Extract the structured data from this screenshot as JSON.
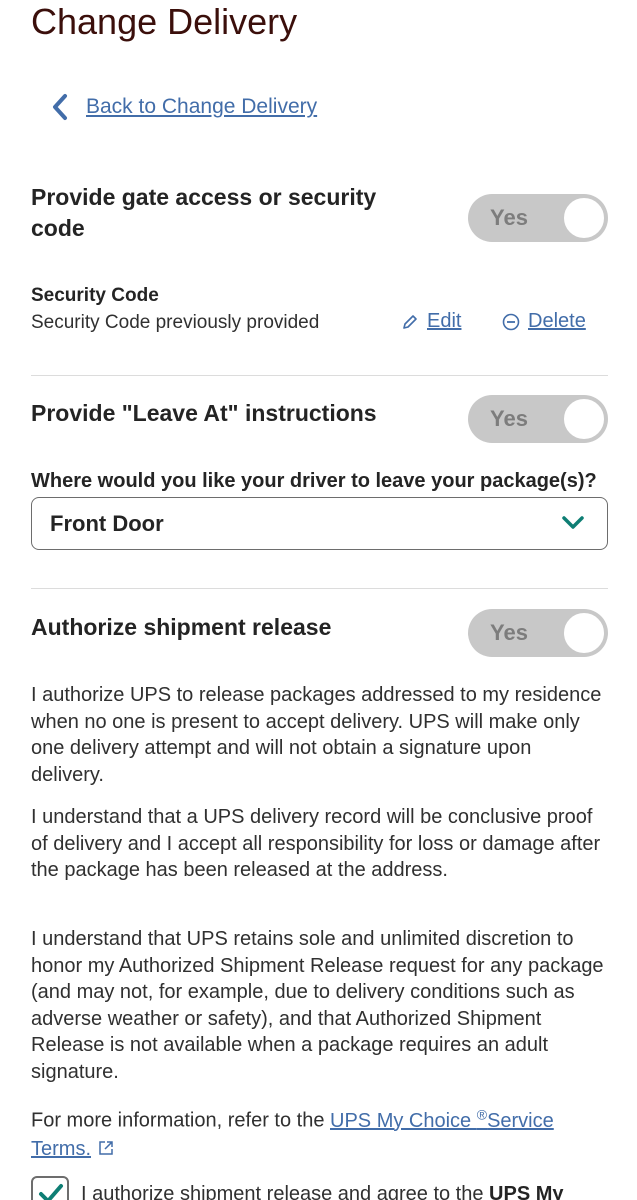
{
  "page_title": "Change Delivery",
  "back_link": "Back to Change Delivery",
  "gate_section": {
    "title_line1": "Provide gate access or security",
    "title_line2": "code",
    "toggle_label": "Yes"
  },
  "security_code": {
    "label": "Security Code",
    "value": "Security Code previously provided",
    "edit_label": "Edit",
    "delete_label": "Delete"
  },
  "leave_at_section": {
    "title": "Provide \"Leave At\" instructions",
    "toggle_label": "Yes",
    "field_label": "Where would you like your driver to leave your package(s)?",
    "selected_value": "Front Door"
  },
  "release_section": {
    "title": "Authorize shipment release",
    "toggle_label": "Yes",
    "paragraphs": [
      "I authorize UPS to release packages addressed to my residence when no one is present to accept delivery. UPS will make only one delivery attempt and will not obtain a signature upon delivery.",
      "I understand that a UPS delivery record will be conclusive proof of delivery and I accept all responsibility for loss or damage after the package has been released at the address.",
      "I understand that UPS retains sole and unlimited discretion to honor my Authorized Shipment Release request for any package (and may not, for example, due to delivery conditions such as adverse weather or safety), and that Authorized Shipment Release is not available when a package requires an adult signature."
    ],
    "more_info_prefix": "For more information, refer to the ",
    "terms_link_part1": "UPS My Choice ",
    "terms_link_sup": "®",
    "terms_link_part2": "Service Terms.",
    "checkbox_text_prefix": "I authorize shipment release and agree to the ",
    "checkbox_text_bold": "UPS My"
  },
  "colors": {
    "title": "#3b0f0b",
    "link": "#426da9",
    "accent_teal": "#0e7e74",
    "toggle_bg": "#c8c8c8"
  },
  "icons": [
    "chevron-left-icon",
    "pencil-icon",
    "minus-circle-icon",
    "chevron-down-icon",
    "external-link-icon",
    "checkmark-icon"
  ]
}
